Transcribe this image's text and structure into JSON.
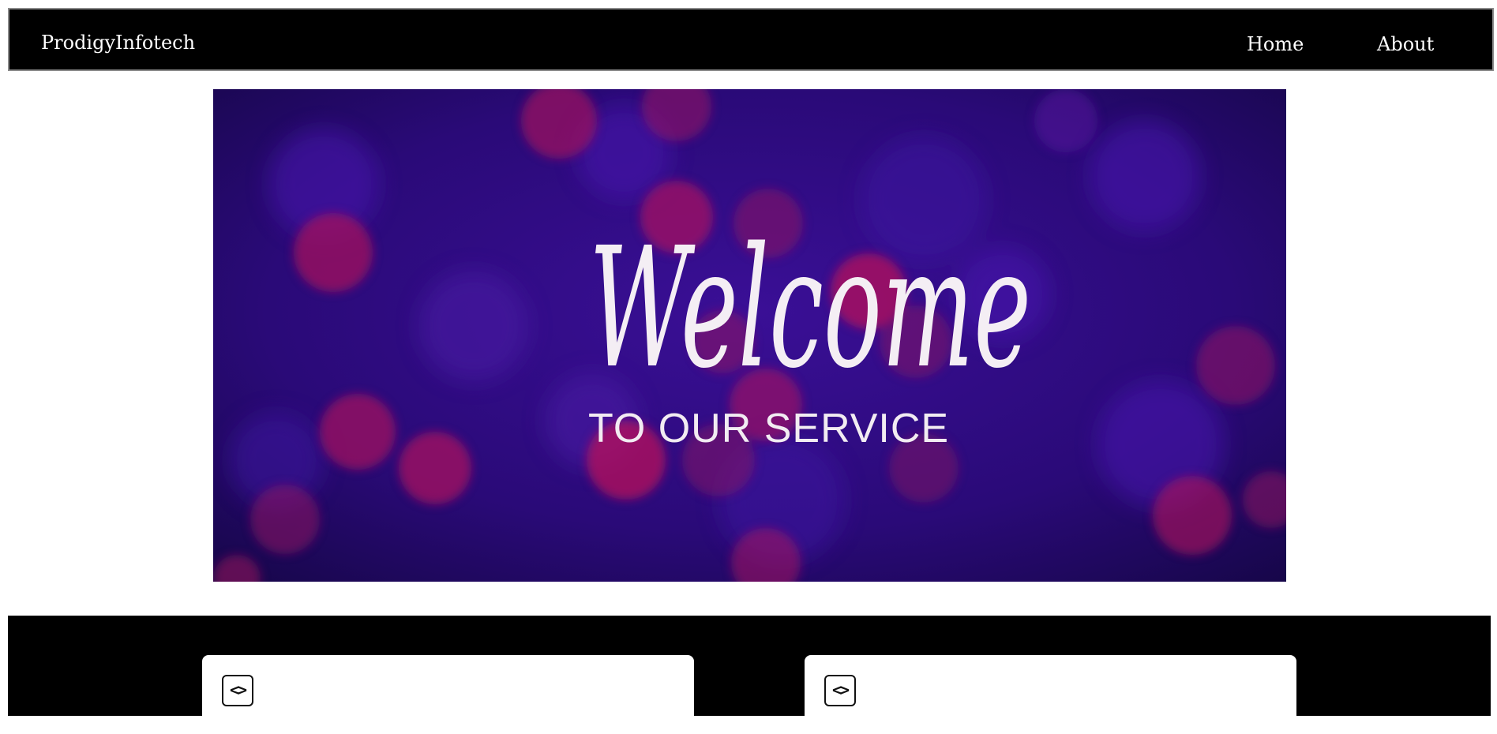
{
  "navbar": {
    "brand": "ProdigyInfotech",
    "links": [
      {
        "label": "Home"
      },
      {
        "label": "About"
      }
    ]
  },
  "hero": {
    "script_text": "Welcome",
    "subtitle": "TO OUR SERVICE",
    "colors": {
      "base": "#2a0a72",
      "bokeh_pink": "#b0125e",
      "bokeh_purple": "#4a16a8"
    }
  },
  "services": {
    "cards": [
      {
        "icon": "code-icon",
        "glyph": "<>"
      },
      {
        "icon": "code-icon",
        "glyph": "<>"
      }
    ]
  }
}
